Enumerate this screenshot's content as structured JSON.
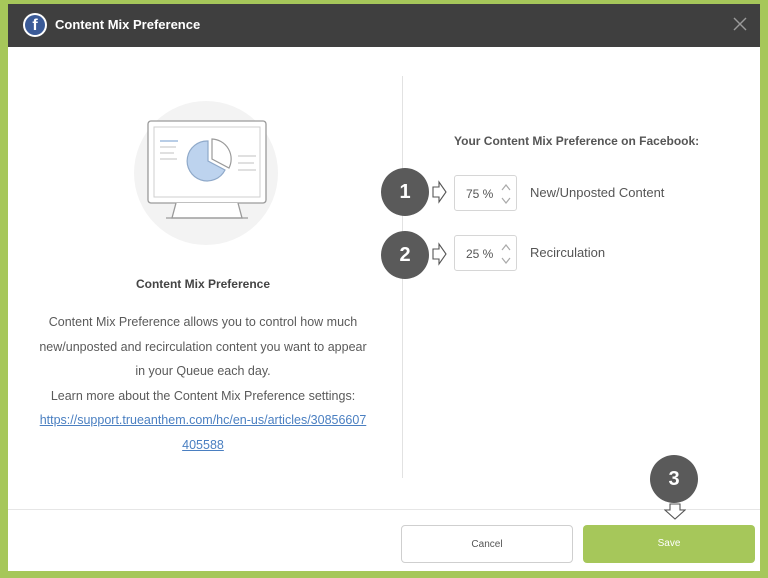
{
  "header": {
    "title": "Content Mix Preference",
    "fb_glyph": "f"
  },
  "left": {
    "title": "Content Mix Preference",
    "description": "Content Mix Preference allows you to control how much new/unposted and recirculation content you want to appear in your Queue each day.",
    "learn_more": "Learn more about the Content Mix Preference settings:",
    "link": "https://support.trueanthem.com/hc/en-us/articles/30856607405588"
  },
  "right": {
    "title": "Your Content Mix Preference on Facebook:",
    "rows": [
      {
        "step": "1",
        "value": "75 %",
        "label": "New/Unposted Content"
      },
      {
        "step": "2",
        "value": "25 %",
        "label": "Recirculation"
      }
    ]
  },
  "footer": {
    "cancel": "Cancel",
    "save": "Save",
    "step": "3"
  },
  "colors": {
    "accent": "#a6c75a",
    "header_bg": "#3f3f3f",
    "badge": "#5a5a5a",
    "link": "#4a7fc1",
    "facebook": "#3b5b98"
  },
  "icons": [
    "facebook-icon",
    "close-icon",
    "monitor-pie-illustration",
    "pointer-arrow-icon",
    "spinner-up-icon",
    "spinner-down-icon"
  ]
}
